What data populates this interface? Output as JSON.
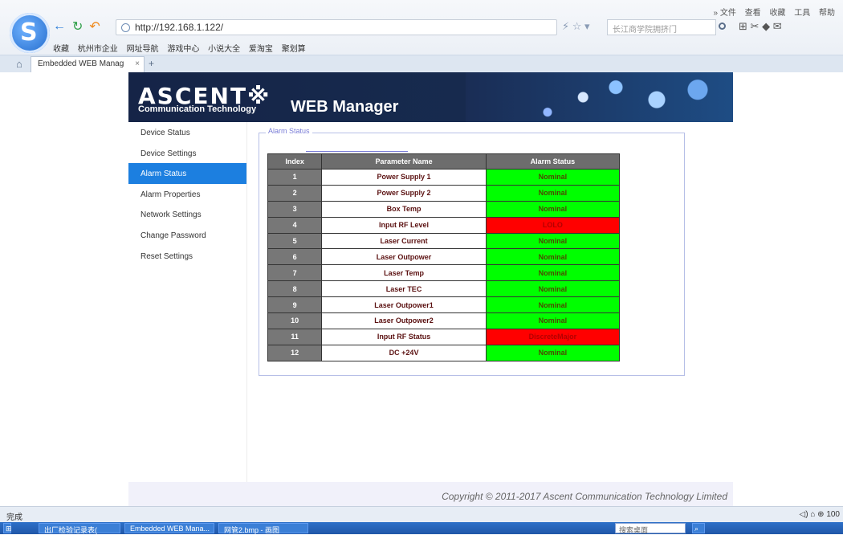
{
  "browser": {
    "top_menu": [
      "» 文件",
      "查看",
      "收藏",
      "工具",
      "帮助"
    ],
    "url": "http://192.168.1.122/",
    "search_placeholder": "长江商学院拥挤门",
    "bookmarks": [
      "收藏",
      "杭州市企业",
      "网址导航",
      "游戏中心",
      "小说大全",
      "爱淘宝",
      "聚划算"
    ],
    "tab_title": "Embedded WEB Manag",
    "tab_close": "×",
    "new_tab": "+"
  },
  "header": {
    "brand": "ASCENT※",
    "subtitle": "Communication Technology",
    "title": "WEB Manager"
  },
  "sidebar": {
    "items": [
      {
        "label": "Device Status"
      },
      {
        "label": "Device Settings"
      },
      {
        "label": "Alarm Status",
        "active": true
      },
      {
        "label": "Alarm Properties"
      },
      {
        "label": "Network Settings"
      },
      {
        "label": "Change Password"
      },
      {
        "label": "Reset Settings"
      }
    ]
  },
  "content": {
    "legend": "Alarm Status",
    "columns": [
      "Index",
      "Parameter Name",
      "Alarm Status"
    ],
    "rows": [
      {
        "index": "1",
        "parameter": "Power Supply 1",
        "status": "Nominal",
        "state": "nominal"
      },
      {
        "index": "2",
        "parameter": "Power Supply 2",
        "status": "Nominal",
        "state": "nominal"
      },
      {
        "index": "3",
        "parameter": "Box Temp",
        "status": "Nominal",
        "state": "nominal"
      },
      {
        "index": "4",
        "parameter": "Input RF Level",
        "status": "LOLO",
        "state": "alarm"
      },
      {
        "index": "5",
        "parameter": "Laser Current",
        "status": "Nominal",
        "state": "nominal"
      },
      {
        "index": "6",
        "parameter": "Laser Outpower",
        "status": "Nominal",
        "state": "nominal"
      },
      {
        "index": "7",
        "parameter": "Laser Temp",
        "status": "Nominal",
        "state": "nominal"
      },
      {
        "index": "8",
        "parameter": "Laser TEC",
        "status": "Nominal",
        "state": "nominal"
      },
      {
        "index": "9",
        "parameter": "Laser Outpower1",
        "status": "Nominal",
        "state": "nominal"
      },
      {
        "index": "10",
        "parameter": "Laser Outpower2",
        "status": "Nominal",
        "state": "nominal"
      },
      {
        "index": "11",
        "parameter": "Input RF Status",
        "status": "DiscreteMajor",
        "state": "alarm"
      },
      {
        "index": "12",
        "parameter": "DC +24V",
        "status": "Nominal",
        "state": "nominal"
      }
    ]
  },
  "footer": "Copyright © 2011-2017 Ascent Communication Technology Limited",
  "status_bar": {
    "left": "完成",
    "right": "100"
  },
  "taskbar": {
    "tasks": [
      "出厂检验记录表(",
      "Embedded WEB Mana...",
      "网管2.bmp - 画图"
    ],
    "desktop": "搜索桌面"
  },
  "colors": {
    "active_menu": "#1c7fe0",
    "nominal": "#00ff00",
    "alarm": "#ff0000",
    "table_header": "#6d6d6d"
  }
}
